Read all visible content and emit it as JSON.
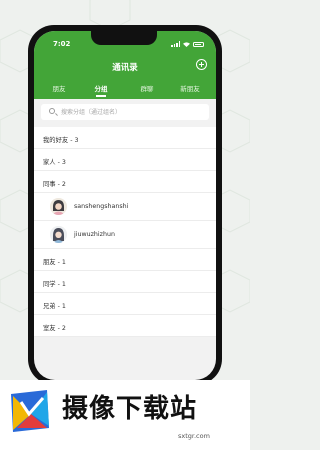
{
  "status": {
    "time": "7:02"
  },
  "header": {
    "title": "通讯录"
  },
  "tabs": [
    {
      "label": "朋友",
      "active": false
    },
    {
      "label": "分组",
      "active": true
    },
    {
      "label": "群聊",
      "active": false
    },
    {
      "label": "新朋友",
      "active": false
    }
  ],
  "search": {
    "placeholder": "搜索分组（通过组名）"
  },
  "groups": [
    {
      "label": "我的好友 - 3"
    },
    {
      "label": "家人 - 3"
    },
    {
      "label": "同事 - 2"
    },
    {
      "label": "朋友 - 1"
    },
    {
      "label": "同学 - 1"
    },
    {
      "label": "兄弟 - 1"
    },
    {
      "label": "室友 - 2"
    }
  ],
  "members": [
    {
      "name": "sanshengshanshi"
    },
    {
      "name": "jiuwuzhizhun"
    }
  ],
  "watermark": {
    "brand": "摄像下载站",
    "url": "sxtgr.com"
  },
  "colors": {
    "accent": "#43a538",
    "background": "#f2f2f2"
  }
}
